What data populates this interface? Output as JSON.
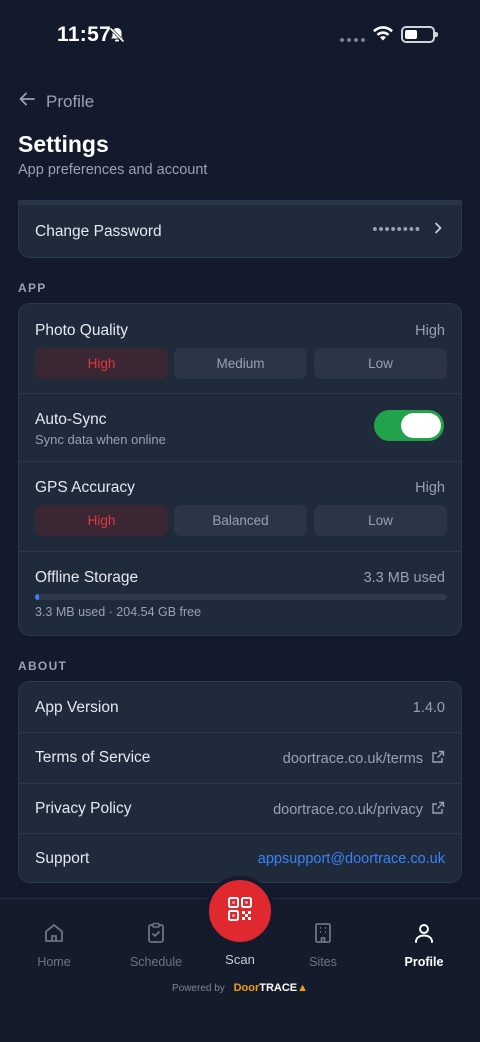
{
  "status_bar": {
    "time": "11:57"
  },
  "header": {
    "back_label": "Profile",
    "title": "Settings",
    "subtitle": "App preferences and account"
  },
  "account": {
    "change_password_label": "Change Password",
    "password_mask": "••••••••"
  },
  "app_section": {
    "header": "APP",
    "photo_quality": {
      "label": "Photo Quality",
      "value": "High",
      "options": [
        "High",
        "Medium",
        "Low"
      ],
      "selected": "High"
    },
    "auto_sync": {
      "label": "Auto-Sync",
      "sublabel": "Sync data when online",
      "enabled": true
    },
    "gps_accuracy": {
      "label": "GPS Accuracy",
      "value": "High",
      "options": [
        "High",
        "Balanced",
        "Low"
      ],
      "selected": "High"
    },
    "offline_storage": {
      "label": "Offline Storage",
      "value": "3.3 MB used",
      "detail": "3.3 MB used · 204.54 GB free",
      "fill_fraction": 0.01
    }
  },
  "about_section": {
    "header": "ABOUT",
    "app_version": {
      "label": "App Version",
      "value": "1.4.0"
    },
    "terms": {
      "label": "Terms of Service",
      "value": "doortrace.co.uk/terms"
    },
    "privacy": {
      "label": "Privacy Policy",
      "value": "doortrace.co.uk/privacy"
    },
    "support": {
      "label": "Support",
      "value": "appsupport@doortrace.co.uk"
    }
  },
  "bottom_nav": {
    "items": [
      {
        "label": "Home",
        "icon": "home-icon"
      },
      {
        "label": "Schedule",
        "icon": "clipboard-check-icon"
      },
      {
        "label": "Scan",
        "icon": "qr-code-icon"
      },
      {
        "label": "Sites",
        "icon": "building-icon"
      },
      {
        "label": "Profile",
        "icon": "user-icon"
      }
    ],
    "active": "Profile"
  },
  "footer": {
    "powered_by": "Powered by",
    "brand_door": "Door",
    "brand_trace": "TRACE"
  },
  "colors": {
    "background": "#121a2b",
    "card": "#1f2a3b",
    "accent_red": "#e0393e",
    "toggle_green": "#22a24a",
    "link_blue": "#3b82f6"
  }
}
